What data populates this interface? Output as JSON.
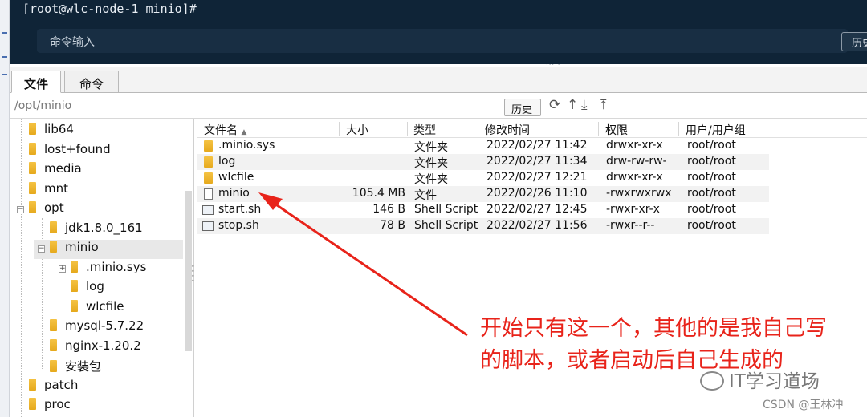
{
  "terminal": {
    "prompt": "[root@wlc-node-1 minio]#",
    "command_placeholder": "命令输入",
    "history_label": "历史"
  },
  "tabs": [
    {
      "label": "文件",
      "active": true
    },
    {
      "label": "命令",
      "active": false
    }
  ],
  "pathbar": {
    "path": "/opt/minio",
    "history_label": "历史",
    "icons": [
      "refresh-icon",
      "up-icon",
      "download-icon",
      "upload-icon"
    ]
  },
  "tree": {
    "items": [
      {
        "label": "lib64"
      },
      {
        "label": "lost+found"
      },
      {
        "label": "media"
      },
      {
        "label": "mnt"
      },
      {
        "label": "opt",
        "expanded": true
      },
      {
        "label": "jdk1.8.0_161"
      },
      {
        "label": "minio",
        "expanded": true,
        "selected": true
      },
      {
        "label": ".minio.sys",
        "collapsed": true
      },
      {
        "label": "log"
      },
      {
        "label": "wlcfile"
      },
      {
        "label": "mysql-5.7.22"
      },
      {
        "label": "nginx-1.20.2"
      },
      {
        "label": "安装包"
      },
      {
        "label": "patch"
      },
      {
        "label": "proc"
      }
    ]
  },
  "list": {
    "columns": [
      "文件名",
      "大小",
      "类型",
      "修改时间",
      "权限",
      "用户/用户组"
    ],
    "sort_indicator": "▲",
    "rows": [
      {
        "name": ".minio.sys",
        "size": "",
        "type": "文件夹",
        "mtime": "2022/02/27 11:42",
        "perm": "drwxr-xr-x",
        "owner": "root/root",
        "icon": "folder"
      },
      {
        "name": "log",
        "size": "",
        "type": "文件夹",
        "mtime": "2022/02/27 11:34",
        "perm": "drw-rw-rw-",
        "owner": "root/root",
        "icon": "folder"
      },
      {
        "name": "wlcfile",
        "size": "",
        "type": "文件夹",
        "mtime": "2022/02/27 12:21",
        "perm": "drwxr-xr-x",
        "owner": "root/root",
        "icon": "folder"
      },
      {
        "name": "minio",
        "size": "105.4 MB",
        "type": "文件",
        "mtime": "2022/02/26 11:10",
        "perm": "-rwxrwxrwx",
        "owner": "root/root",
        "icon": "file"
      },
      {
        "name": "start.sh",
        "size": "146 B",
        "type": "Shell Script",
        "mtime": "2022/02/27 12:45",
        "perm": "-rwxr-xr-x",
        "owner": "root/root",
        "icon": "script"
      },
      {
        "name": "stop.sh",
        "size": "78 B",
        "type": "Shell Script",
        "mtime": "2022/02/27 11:56",
        "perm": "-rwxr--r--",
        "owner": "root/root",
        "icon": "script"
      }
    ]
  },
  "annotation": {
    "line1": "开始只有这一个，其他的是我自己写",
    "line2": "的脚本，或者启动后自己生成的",
    "color": "#e8231a"
  },
  "watermark": {
    "brand": "IT学习道场",
    "credit": "CSDN @王林冲"
  }
}
